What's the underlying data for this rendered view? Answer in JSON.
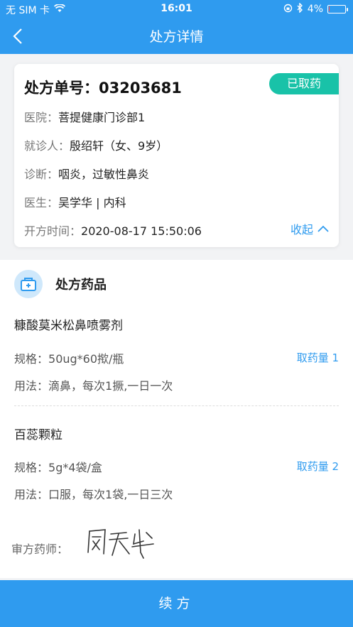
{
  "status": {
    "carrier": "无 SIM 卡",
    "time": "16:01",
    "battery": "4%",
    "battery_level": 0.04
  },
  "nav": {
    "title": "处方详情"
  },
  "card": {
    "rx_no_label": "处方单号：",
    "rx_no": "03203681",
    "badge": "已取药",
    "hospital_label": "医院：",
    "hospital": "菩提健康门诊部1",
    "patient_label": "就诊人：",
    "patient": "殷绍轩（女、9岁）",
    "diagnosis_label": "诊断：",
    "diagnosis": "咽炎，过敏性鼻炎",
    "doctor_label": "医生：",
    "doctor": "吴学华 | 内科",
    "time_label": "开方时间：",
    "time": "2020-08-17 15:50:06",
    "collapse": "收起"
  },
  "drugs": {
    "title": "处方药品",
    "items": [
      {
        "name": "糠酸莫米松鼻喷雾剂",
        "spec_label": "规格：",
        "spec": "50ug*60揿/瓶",
        "usage_label": "用法：",
        "usage": "滴鼻，每次1撅,一日一次",
        "qty": "取药量 1"
      },
      {
        "name": "百蕊颗粒",
        "spec_label": "规格：",
        "spec": "5g*4袋/盒",
        "usage_label": "用法：",
        "usage": "口服，每次1袋,一日三次",
        "qty": "取药量 2"
      }
    ]
  },
  "pharmacist": {
    "label": "审方药师：",
    "signature": "周天华"
  },
  "footer": {
    "renew": "续方"
  },
  "colors": {
    "primary": "#2f9bef",
    "badge": "#19c2a8"
  }
}
